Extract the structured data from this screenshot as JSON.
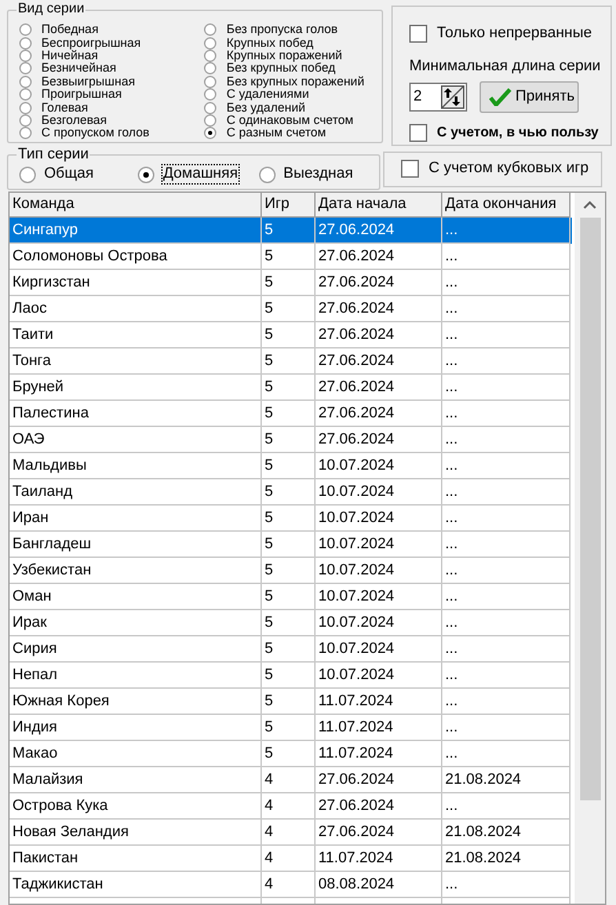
{
  "series_kind": {
    "title": "Вид серии",
    "options": [
      {
        "label": "Победная",
        "selected": false
      },
      {
        "label": "Беспроигрышная",
        "selected": false
      },
      {
        "label": "Ничейная",
        "selected": false
      },
      {
        "label": "Безничейная",
        "selected": false
      },
      {
        "label": "Безвыигрышная",
        "selected": false
      },
      {
        "label": "Проигрышная",
        "selected": false
      },
      {
        "label": "Голевая",
        "selected": false
      },
      {
        "label": "Безголевая",
        "selected": false
      },
      {
        "label": "С пропуском голов",
        "selected": false
      },
      {
        "label": "Без пропуска голов",
        "selected": false
      },
      {
        "label": "Крупных побед",
        "selected": false
      },
      {
        "label": "Крупных поражений",
        "selected": false
      },
      {
        "label": "Без крупных побед",
        "selected": false
      },
      {
        "label": "Без крупных поражений",
        "selected": false
      },
      {
        "label": "С удалениями",
        "selected": false
      },
      {
        "label": "Без удалений",
        "selected": false
      },
      {
        "label": "С одинаковым счетом",
        "selected": false
      },
      {
        "label": "С разным счетом",
        "selected": true
      }
    ]
  },
  "options_panel": {
    "only_unbroken": {
      "label": "Только непрерванные",
      "checked": false
    },
    "min_length_label": "Минимальная длина серии",
    "min_length_value": "2",
    "apply_button": "Принять",
    "in_favor": {
      "label": "С учетом, в чью пользу",
      "checked": false
    }
  },
  "series_type": {
    "title": "Тип серии",
    "options": [
      {
        "label": "Общая",
        "selected": false
      },
      {
        "label": "Домашняя",
        "selected": true
      },
      {
        "label": "Выездная",
        "selected": false
      }
    ]
  },
  "cup_games": {
    "label": "С учетом кубковых игр",
    "checked": false
  },
  "table": {
    "columns": [
      "Команда",
      "Игр",
      "Дата начала",
      "Дата окончания"
    ],
    "rows": [
      {
        "cells": [
          "Сингапур",
          "5",
          "27.06.2024",
          "..."
        ],
        "selected": true
      },
      {
        "cells": [
          "Соломоновы Острова",
          "5",
          "27.06.2024",
          "..."
        ],
        "selected": false
      },
      {
        "cells": [
          "Киргизстан",
          "5",
          "27.06.2024",
          "..."
        ],
        "selected": false
      },
      {
        "cells": [
          "Лаос",
          "5",
          "27.06.2024",
          "..."
        ],
        "selected": false
      },
      {
        "cells": [
          "Таити",
          "5",
          "27.06.2024",
          "..."
        ],
        "selected": false
      },
      {
        "cells": [
          "Тонга",
          "5",
          "27.06.2024",
          "..."
        ],
        "selected": false
      },
      {
        "cells": [
          "Бруней",
          "5",
          "27.06.2024",
          "..."
        ],
        "selected": false
      },
      {
        "cells": [
          "Палестина",
          "5",
          "27.06.2024",
          "..."
        ],
        "selected": false
      },
      {
        "cells": [
          "ОАЭ",
          "5",
          "27.06.2024",
          "..."
        ],
        "selected": false
      },
      {
        "cells": [
          "Мальдивы",
          "5",
          "10.07.2024",
          "..."
        ],
        "selected": false
      },
      {
        "cells": [
          "Таиланд",
          "5",
          "10.07.2024",
          "..."
        ],
        "selected": false
      },
      {
        "cells": [
          "Иран",
          "5",
          "10.07.2024",
          "..."
        ],
        "selected": false
      },
      {
        "cells": [
          "Бангладеш",
          "5",
          "10.07.2024",
          "..."
        ],
        "selected": false
      },
      {
        "cells": [
          "Узбекистан",
          "5",
          "10.07.2024",
          "..."
        ],
        "selected": false
      },
      {
        "cells": [
          "Оман",
          "5",
          "10.07.2024",
          "..."
        ],
        "selected": false
      },
      {
        "cells": [
          "Ирак",
          "5",
          "10.07.2024",
          "..."
        ],
        "selected": false
      },
      {
        "cells": [
          "Сирия",
          "5",
          "10.07.2024",
          "..."
        ],
        "selected": false
      },
      {
        "cells": [
          "Непал",
          "5",
          "10.07.2024",
          "..."
        ],
        "selected": false
      },
      {
        "cells": [
          "Южная Корея",
          "5",
          "11.07.2024",
          "..."
        ],
        "selected": false
      },
      {
        "cells": [
          "Индия",
          "5",
          "11.07.2024",
          "..."
        ],
        "selected": false
      },
      {
        "cells": [
          "Макао",
          "5",
          "11.07.2024",
          "..."
        ],
        "selected": false
      },
      {
        "cells": [
          "Малайзия",
          "4",
          "27.06.2024",
          "21.08.2024"
        ],
        "selected": false
      },
      {
        "cells": [
          "Острова Кука",
          "4",
          "27.06.2024",
          "..."
        ],
        "selected": false
      },
      {
        "cells": [
          "Новая Зеландия",
          "4",
          "27.06.2024",
          "21.08.2024"
        ],
        "selected": false
      },
      {
        "cells": [
          "Пакистан",
          "4",
          "11.07.2024",
          "21.08.2024"
        ],
        "selected": false
      },
      {
        "cells": [
          "Таджикистан",
          "4",
          "08.08.2024",
          "..."
        ],
        "selected": false
      }
    ]
  }
}
